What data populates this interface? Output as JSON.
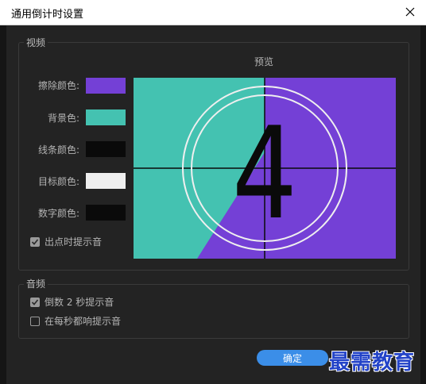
{
  "window": {
    "title": "通用倒计时设置"
  },
  "video_group": {
    "title": "视频",
    "preview_label": "预览",
    "wipe_color": {
      "label": "擦除颜色:",
      "color": "#7440d6"
    },
    "background_color": {
      "label": "背景色:",
      "color": "#44c2b1"
    },
    "line_color": {
      "label": "线条颜色:",
      "color": "#0a0a0a"
    },
    "target_color": {
      "label": "目标颜色:",
      "color": "#efefef"
    },
    "digit_color": {
      "label": "数字颜色:",
      "color": "#0a0a0a"
    },
    "cue_at_out": {
      "label": "出点时提示音",
      "checked": true
    },
    "preview_digit": "4"
  },
  "audio_group": {
    "title": "音频",
    "cue_2_sec": {
      "label": "倒数 2 秒提示音",
      "checked": true
    },
    "cue_every_sec": {
      "label": "在每秒都响提示音",
      "checked": false
    }
  },
  "buttons": {
    "ok_label": "确定",
    "ok_color": "#3b8ee8"
  },
  "watermark": {
    "text": "最需教育"
  }
}
